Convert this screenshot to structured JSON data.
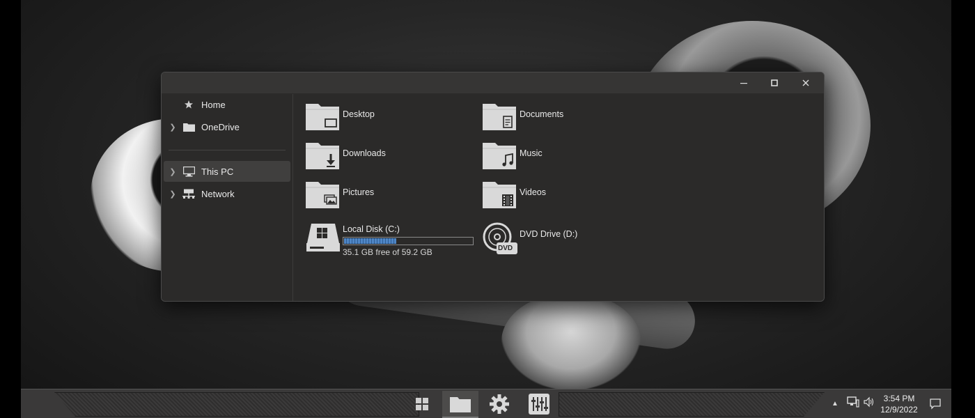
{
  "window": {
    "controls": {
      "minimize": "—",
      "maximize": "☐",
      "close": "✕"
    }
  },
  "nav": {
    "items": [
      {
        "label": "Home",
        "icon": "star-icon",
        "expandable": false
      },
      {
        "label": "OneDrive",
        "icon": "folder-icon",
        "expandable": true
      },
      {
        "label": "This PC",
        "icon": "monitor-icon",
        "expandable": true,
        "selected": true
      },
      {
        "label": "Network",
        "icon": "network-icon",
        "expandable": true
      }
    ]
  },
  "folders": [
    {
      "label": "Desktop",
      "icon": "desktop-folder-icon"
    },
    {
      "label": "Documents",
      "icon": "documents-folder-icon"
    },
    {
      "label": "Downloads",
      "icon": "downloads-folder-icon"
    },
    {
      "label": "Music",
      "icon": "music-folder-icon"
    },
    {
      "label": "Pictures",
      "icon": "pictures-folder-icon"
    },
    {
      "label": "Videos",
      "icon": "videos-folder-icon"
    }
  ],
  "drives": [
    {
      "label": "Local Disk (C:)",
      "free_text": "35.1 GB free of 59.2 GB",
      "used_fraction": 0.41,
      "icon": "hard-drive-icon"
    },
    {
      "label": "DVD Drive (D:)",
      "icon": "dvd-drive-icon",
      "badge": "DVD"
    }
  ],
  "taskbar": {
    "apps": [
      {
        "name": "start",
        "icon": "windows-start-icon"
      },
      {
        "name": "file-explorer",
        "icon": "folder-icon",
        "active": true
      },
      {
        "name": "settings",
        "icon": "gear-icon"
      },
      {
        "name": "control-panel",
        "icon": "sliders-icon"
      }
    ],
    "clock": {
      "time": "3:54 PM",
      "date": "12/9/2022"
    },
    "tray_icons": [
      "chevron-up-icon",
      "network-icon",
      "volume-icon",
      "notifications-icon"
    ]
  },
  "colors": {
    "accent_bar": "#4f86c6",
    "window_bg": "#2b2a29",
    "titlebar_bg": "#363534",
    "folder": "#d9d9d9"
  }
}
